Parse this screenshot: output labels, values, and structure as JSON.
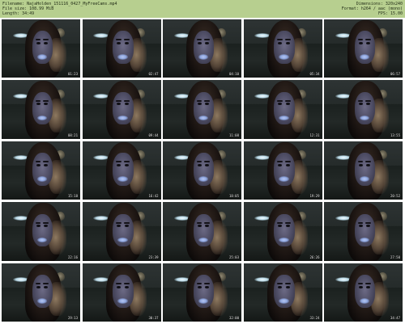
{
  "header": {
    "filename": "Filename: NajaHolden_151116_0427_MyFreeCams.mp4",
    "filesize": "File size: 108.99 MiB",
    "length": "Length: 34:49",
    "dimensions": "Dimensions: 320x240",
    "format": "Format: h264 / aac (mono)",
    "fps": "FPS: 15.00"
  },
  "thumbnails": [
    {
      "time": "01:23"
    },
    {
      "time": "02:47"
    },
    {
      "time": "04:10"
    },
    {
      "time": "05:34"
    },
    {
      "time": "06:57"
    },
    {
      "time": "08:21"
    },
    {
      "time": "09:44"
    },
    {
      "time": "11:08"
    },
    {
      "time": "12:31"
    },
    {
      "time": "13:55"
    },
    {
      "time": "15:18"
    },
    {
      "time": "16:42"
    },
    {
      "time": "18:05"
    },
    {
      "time": "19:29"
    },
    {
      "time": "20:52"
    },
    {
      "time": "22:16"
    },
    {
      "time": "23:39"
    },
    {
      "time": "25:03"
    },
    {
      "time": "26:26"
    },
    {
      "time": "27:50"
    },
    {
      "time": "29:13"
    },
    {
      "time": "30:37"
    },
    {
      "time": "32:00"
    },
    {
      "time": "33:24"
    },
    {
      "time": "34:47"
    }
  ],
  "colors": {
    "header_bg": "#b7cf8f",
    "sheet_bg": "#ffffff"
  }
}
